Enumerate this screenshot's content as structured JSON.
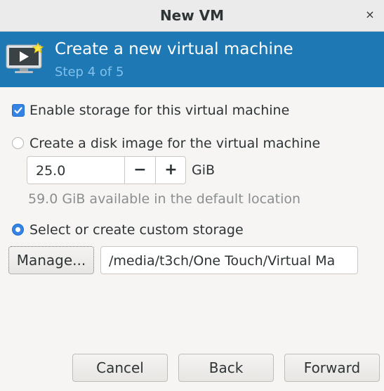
{
  "window": {
    "title": "New VM",
    "close_glyph": "×"
  },
  "header": {
    "icon": "virtual-machine-monitor-icon",
    "title": "Create a new virtual machine",
    "step": "Step 4 of 5",
    "colors": {
      "background": "#1d78b4",
      "step_text": "#80c0ec"
    }
  },
  "storage": {
    "enable_label": "Enable storage for this virtual machine",
    "enable_checked": true,
    "disk_image_label": "Create a disk image for the virtual machine",
    "disk_image_selected": false,
    "size_value": "25.0",
    "size_unit": "GiB",
    "minus_glyph": "−",
    "plus_glyph": "+",
    "available_text": "59.0 GiB available in the default location",
    "custom_label": "Select or create custom storage",
    "custom_selected": true,
    "manage_label": "Manage...",
    "custom_path": "/media/t3ch/One Touch/Virtual Ma"
  },
  "footer": {
    "cancel_label": "Cancel",
    "back_label": "Back",
    "forward_label": "Forward"
  },
  "colors": {
    "accent": "#3584e4"
  }
}
